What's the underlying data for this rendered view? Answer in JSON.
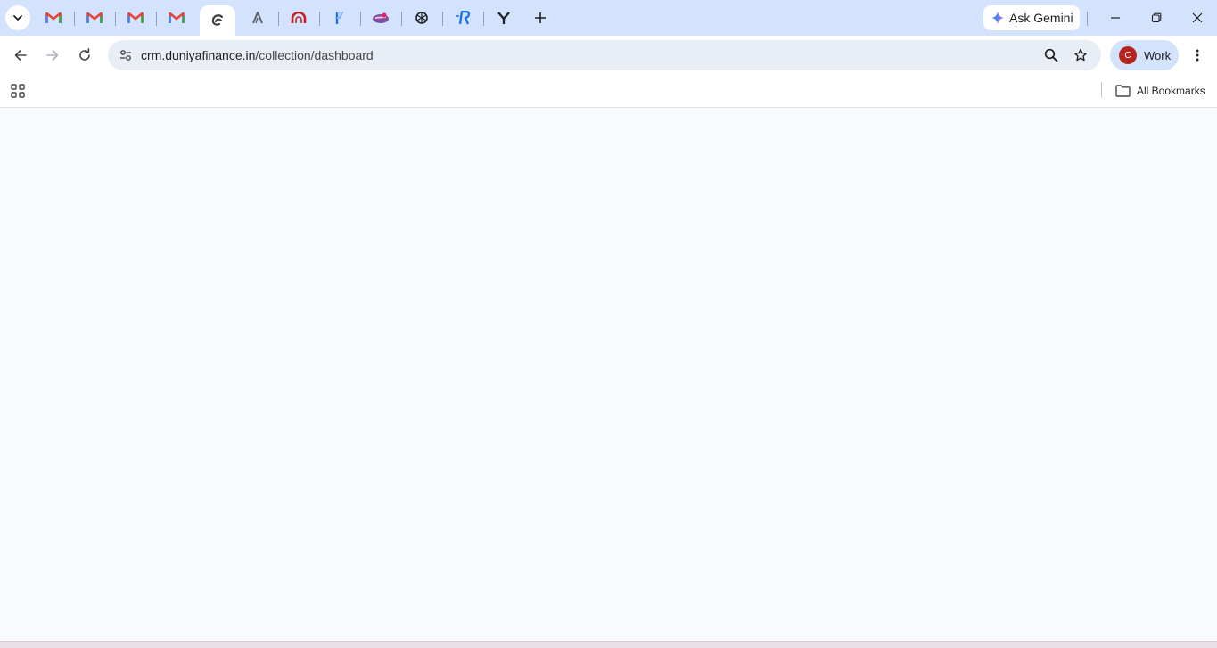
{
  "colors": {
    "tabstrip_bg": "#d3e3fd",
    "toolbar_bg": "#ffffff",
    "omnibox_bg": "#e9eef6",
    "content_bg": "#f8fafd",
    "gmail_red": "#ea4335",
    "avatar_bg": "#b3261e"
  },
  "tabs": [
    {
      "icon": "gmail-icon",
      "active": false
    },
    {
      "icon": "gmail-icon",
      "active": false
    },
    {
      "icon": "gmail-icon",
      "active": false
    },
    {
      "icon": "gmail-icon",
      "active": false
    },
    {
      "icon": "swirl-logo-icon",
      "active": true
    },
    {
      "icon": "letter-a-logo-icon",
      "active": false
    },
    {
      "icon": "red-arch-logo-icon",
      "active": false
    },
    {
      "icon": "blue-brand-logo-icon",
      "active": false
    },
    {
      "icon": "colorful-logo-icon",
      "active": false
    },
    {
      "icon": "openai-logo-icon",
      "active": false
    },
    {
      "icon": "letter-r-logo-icon",
      "active": false
    },
    {
      "icon": "letter-y-logo-icon",
      "active": false
    }
  ],
  "gemini": {
    "label": "Ask Gemini"
  },
  "omnibox": {
    "domain": "crm.duniyafinance.in",
    "path": "/collection/dashboard"
  },
  "profile": {
    "initial": "C",
    "label": "Work"
  },
  "bookmarks_bar": {
    "all_bookmarks_label": "All Bookmarks"
  }
}
